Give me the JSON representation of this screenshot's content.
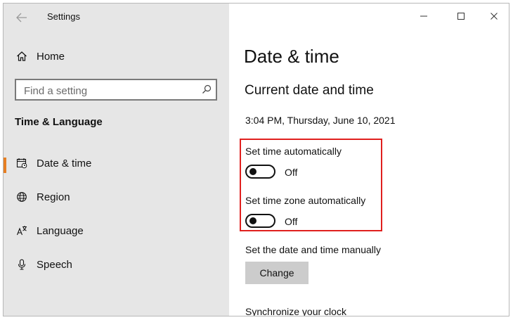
{
  "window": {
    "title": "Settings",
    "controls": [
      "minimize-icon",
      "maximize-icon",
      "close-icon"
    ]
  },
  "sidebar": {
    "home_label": "Home",
    "search": {
      "placeholder": "Find a setting",
      "value": ""
    },
    "section_title": "Time & Language",
    "items": [
      {
        "label": "Date & time",
        "icon": "calendar-clock-icon",
        "active": true
      },
      {
        "label": "Region",
        "icon": "globe-icon",
        "active": false
      },
      {
        "label": "Language",
        "icon": "language-icon",
        "active": false
      },
      {
        "label": "Speech",
        "icon": "microphone-icon",
        "active": false
      }
    ]
  },
  "main": {
    "page_title": "Date & time",
    "subheading": "Current date and time",
    "current_datetime": "3:04 PM, Thursday, June 10, 2021",
    "settings": [
      {
        "label": "Set time automatically",
        "state": "Off"
      },
      {
        "label": "Set time zone automatically",
        "state": "Off"
      }
    ],
    "manual_label": "Set the date and time manually",
    "change_button": "Change",
    "sync_label": "Synchronize your clock"
  },
  "colors": {
    "accent": "#e67e22",
    "highlight_border": "#e0201e",
    "sidebar_bg": "#e6e6e6",
    "button_bg": "#cccccc"
  }
}
